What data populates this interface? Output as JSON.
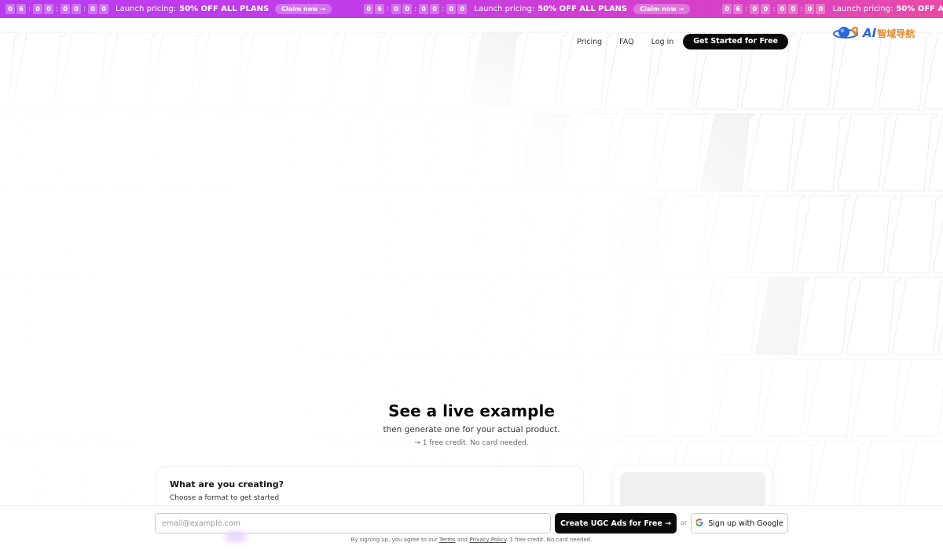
{
  "promo": {
    "digits": [
      "0",
      "6",
      "0",
      "0",
      "0",
      "0",
      "0",
      "0"
    ],
    "text": "Launch pricing:",
    "strong": "50% OFF ALL PLANS",
    "claim": "Claim now →"
  },
  "nav": {
    "pricing": "Pricing",
    "faq": "FAQ",
    "login": "Log in",
    "cta": "Get Started for Free"
  },
  "logo": {
    "ai": "AI",
    "cn": "智域导航"
  },
  "hero": {
    "title": "See a live example",
    "subtitle": "then generate one for your actual product.",
    "note": "→ 1 free credit. No card needed."
  },
  "card": {
    "title": "What are you creating?",
    "subtitle": "Choose a format to get started"
  },
  "signup": {
    "email_placeholder": "email@example.com",
    "create": "Create UGC Ads for Free →",
    "or": "or",
    "google": "Sign up with Google",
    "legal_prefix": "By signing up, you agree to our",
    "terms": "Terms",
    "and": "and",
    "privacy": "Privacy Policy",
    "legal_suffix": ". 1 free credit. No card needed."
  },
  "colors": {
    "promo_start": "#b93cf0",
    "promo_end": "#ea4aa6",
    "cta": "#0a0a0a"
  },
  "icons": {
    "google": "google-icon",
    "logo": "globe-logo-icon"
  }
}
